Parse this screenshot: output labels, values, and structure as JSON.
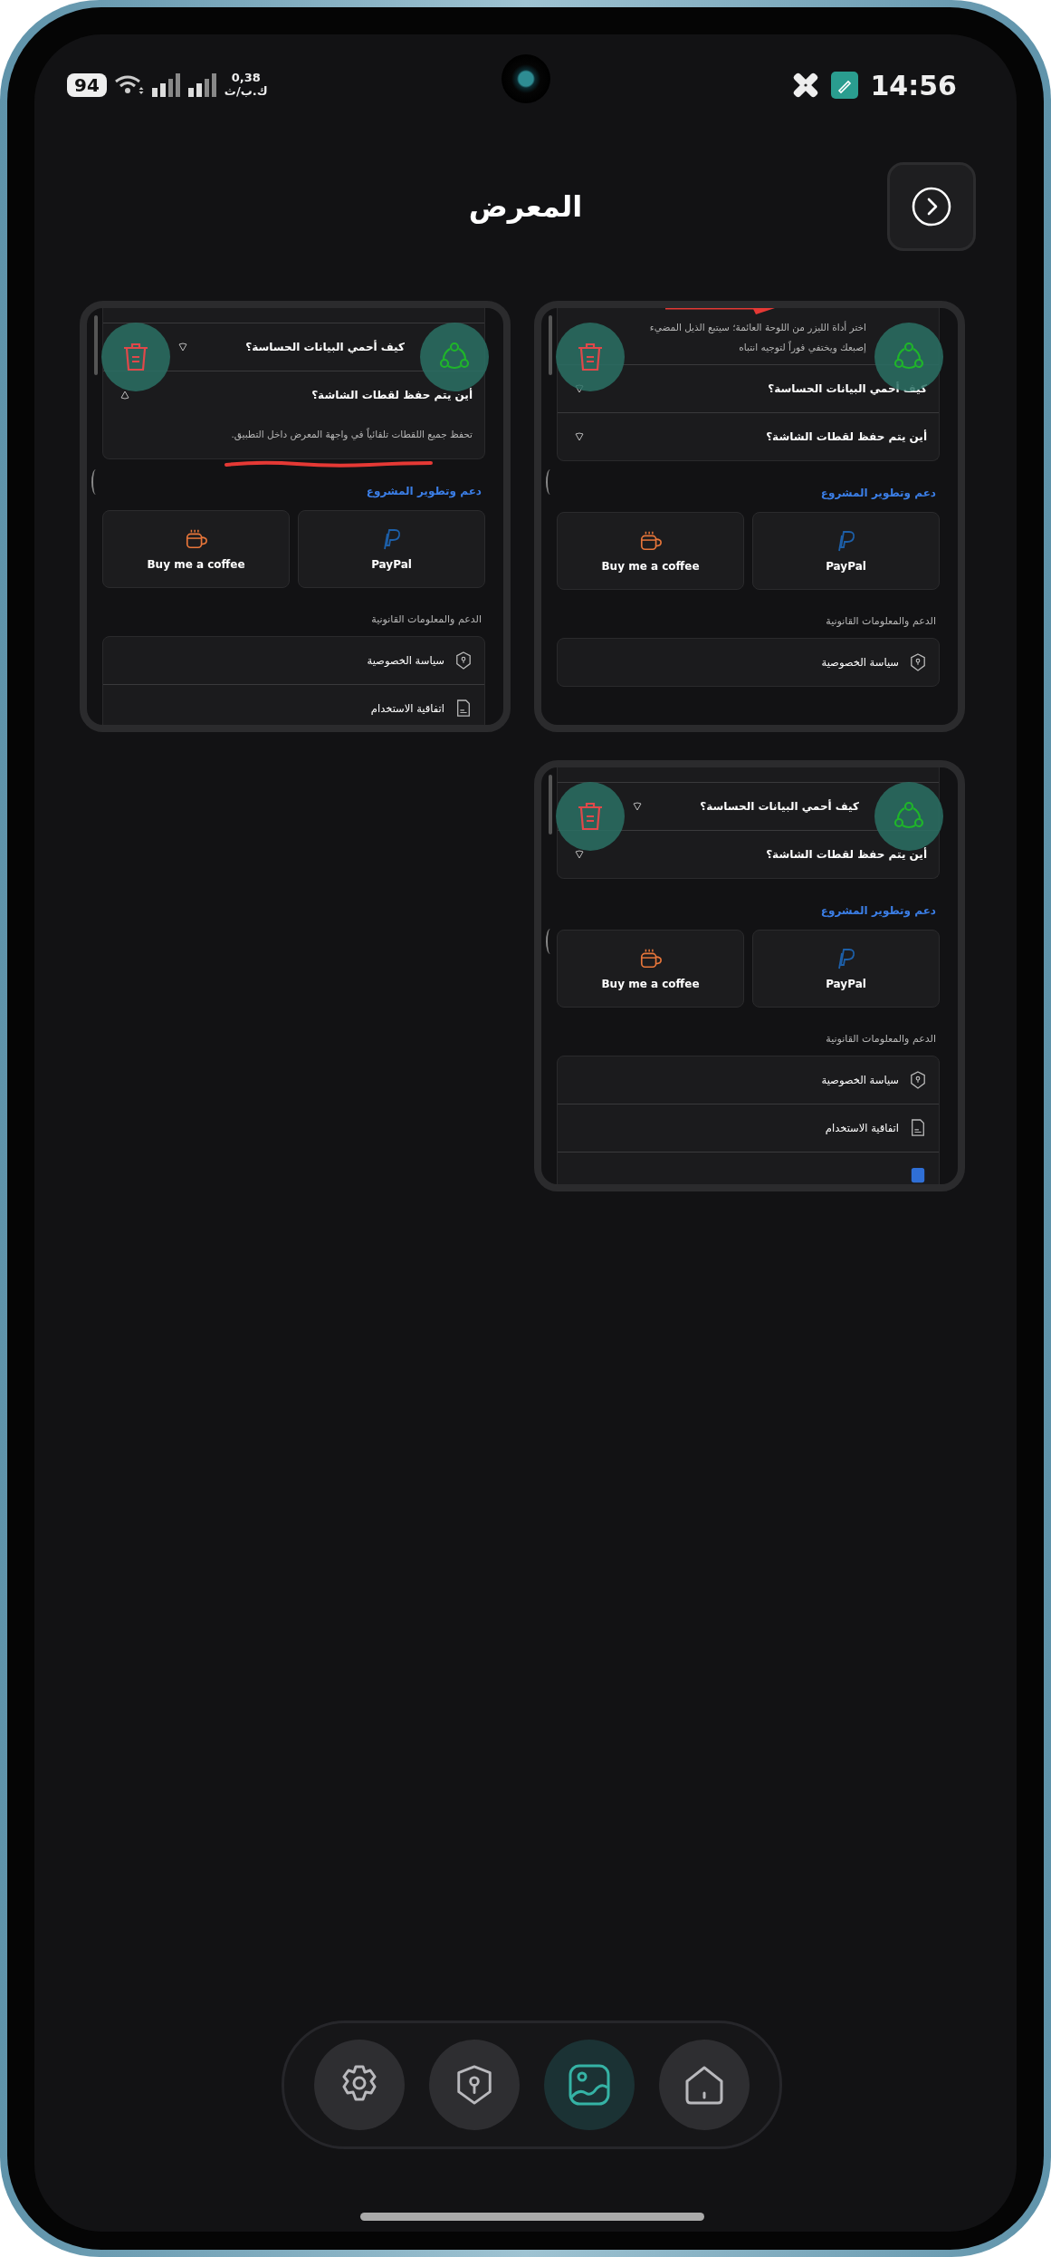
{
  "status_bar": {
    "battery": "94",
    "speed_value": "0,38",
    "speed_unit": "ك.ب/ث",
    "time": "14:56"
  },
  "header": {
    "title": "المعرض"
  },
  "gallery": [
    {
      "annotation": {
        "kind": "arrow"
      },
      "faq": [
        {
          "expanded": true,
          "answer": "اختر أداة الليزر من اللوحة العائمة؛ سيتبع الذيل المضيء إصبعك ويختفي فوراً لتوجيه انتباه"
        },
        {
          "question": "كيف أحمي البيانات الحساسة؟",
          "expanded": false
        },
        {
          "question": "أين يتم حفظ لقطات الشاشة؟",
          "expanded": false
        }
      ],
      "support_heading": "دعم وتطوير المشروع",
      "donate_buttons": [
        {
          "kind": "paypal",
          "label": "PayPal"
        },
        {
          "kind": "coffee",
          "label": "Buy me a coffee"
        }
      ],
      "legal_heading": "الدعم والمعلومات القانونية",
      "legal_items": [
        {
          "kind": "privacy",
          "label": "سياسة الخصوصية"
        }
      ]
    },
    {
      "annotation": {
        "kind": "underline"
      },
      "faq": [
        {
          "question": "كيف أحمي البيانات الحساسة؟",
          "expanded": false
        },
        {
          "question": "أين يتم حفظ لقطات الشاشة؟",
          "expanded": true,
          "answer": "تحفظ جميع اللقطات تلقائياً في واجهة المعرض داخل التطبيق."
        }
      ],
      "support_heading": "دعم وتطوير المشروع",
      "donate_buttons": [
        {
          "kind": "paypal",
          "label": "PayPal"
        },
        {
          "kind": "coffee",
          "label": "Buy me a coffee"
        }
      ],
      "legal_heading": "الدعم والمعلومات القانونية",
      "legal_items": [
        {
          "kind": "privacy",
          "label": "سياسة الخصوصية"
        },
        {
          "kind": "terms",
          "label": "اتفاقية الاستخدام"
        }
      ]
    },
    {
      "faq": [
        {
          "question": "كيف أحمي البيانات الحساسة؟",
          "expanded": false
        },
        {
          "question": "أين يتم حفظ لقطات الشاشة؟",
          "expanded": false
        }
      ],
      "support_heading": "دعم وتطوير المشروع",
      "donate_buttons": [
        {
          "kind": "paypal",
          "label": "PayPal"
        },
        {
          "kind": "coffee",
          "label": "Buy me a coffee"
        }
      ],
      "legal_heading": "الدعم والمعلومات القانونية",
      "legal_items": [
        {
          "kind": "privacy",
          "label": "سياسة الخصوصية"
        },
        {
          "kind": "terms",
          "label": "اتفاقية الاستخدام"
        },
        {
          "kind": "other"
        }
      ]
    }
  ],
  "nav": [
    {
      "kind": "home",
      "selected": false
    },
    {
      "kind": "gallery",
      "selected": true
    },
    {
      "kind": "security",
      "selected": false
    },
    {
      "kind": "settings",
      "selected": false
    }
  ]
}
